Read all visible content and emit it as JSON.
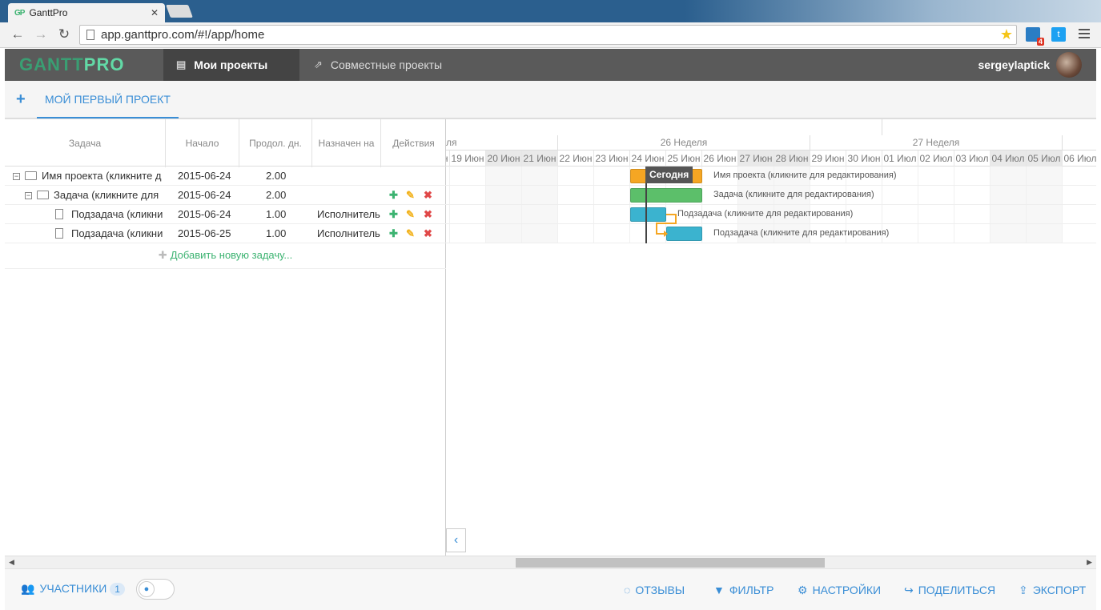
{
  "browser": {
    "tab_title": "GanttPro",
    "tab_favicon": "GP",
    "url": "app.ganttpro.com/#!/app/home",
    "extension_badge": "4"
  },
  "header": {
    "logo_a": "GANTT",
    "logo_b": "PRO",
    "nav": [
      {
        "label": "Мои проекты",
        "icon": "document-icon"
      },
      {
        "label": "Совместные проекты",
        "icon": "share-icon"
      }
    ],
    "username": "sergeylaptick"
  },
  "project_bar": {
    "add_icon": "+",
    "project_title": "МОЙ ПЕРВЫЙ ПРОЕКТ"
  },
  "grid": {
    "columns": [
      "Задача",
      "Начало",
      "Продол. дн.",
      "Назначен на",
      "Действия"
    ],
    "rows": [
      {
        "name": "Имя проекта (кликните д",
        "start": "2015-06-24",
        "duration": "2.00",
        "assignee": ""
      },
      {
        "name": "Задача (кликните для",
        "start": "2015-06-24",
        "duration": "2.00",
        "assignee": ""
      },
      {
        "name": "Подзадача (кликни",
        "start": "2015-06-24",
        "duration": "1.00",
        "assignee": "Исполнитель"
      },
      {
        "name": "Подзадача (кликни",
        "start": "2015-06-25",
        "duration": "1.00",
        "assignee": "Исполнитель"
      }
    ],
    "add_task": "Добавить новую задачу..."
  },
  "chart": {
    "weeks": [
      "ля",
      "26 Неделя",
      "27 Неделя"
    ],
    "days": [
      "19 Июн",
      "19 Июн",
      "20 Июн",
      "21 Июн",
      "22 Июн",
      "23 Июн",
      "24 Июн",
      "25 Июн",
      "26 Июн",
      "27 Июн",
      "28 Июн",
      "29 Июн",
      "30 Июн",
      "01 Июл",
      "02 Июл",
      "03 Июл",
      "04 Июл",
      "05 Июл",
      "06 Июл"
    ],
    "today_label": "Сегодня",
    "bars": [
      {
        "label": "Имя проекта (кликните для редактирования)",
        "color": "#f5a623"
      },
      {
        "label": "Задача (кликните для редактирования)",
        "color": "#5cbf6a"
      },
      {
        "label": "Подзадача (кликните для редактирования)",
        "color": "#3bb3cf"
      },
      {
        "label": "Подзадача (кликните для редактирования)",
        "color": "#3bb3cf"
      }
    ]
  },
  "footer": {
    "participants": "УЧАСТНИКИ",
    "participants_count": "1",
    "feedback": "ОТЗЫВЫ",
    "filter": "ФИЛЬТР",
    "settings": "НАСТРОЙКИ",
    "share": "ПОДЕЛИТЬСЯ",
    "export": "ЭКСПОРТ"
  }
}
